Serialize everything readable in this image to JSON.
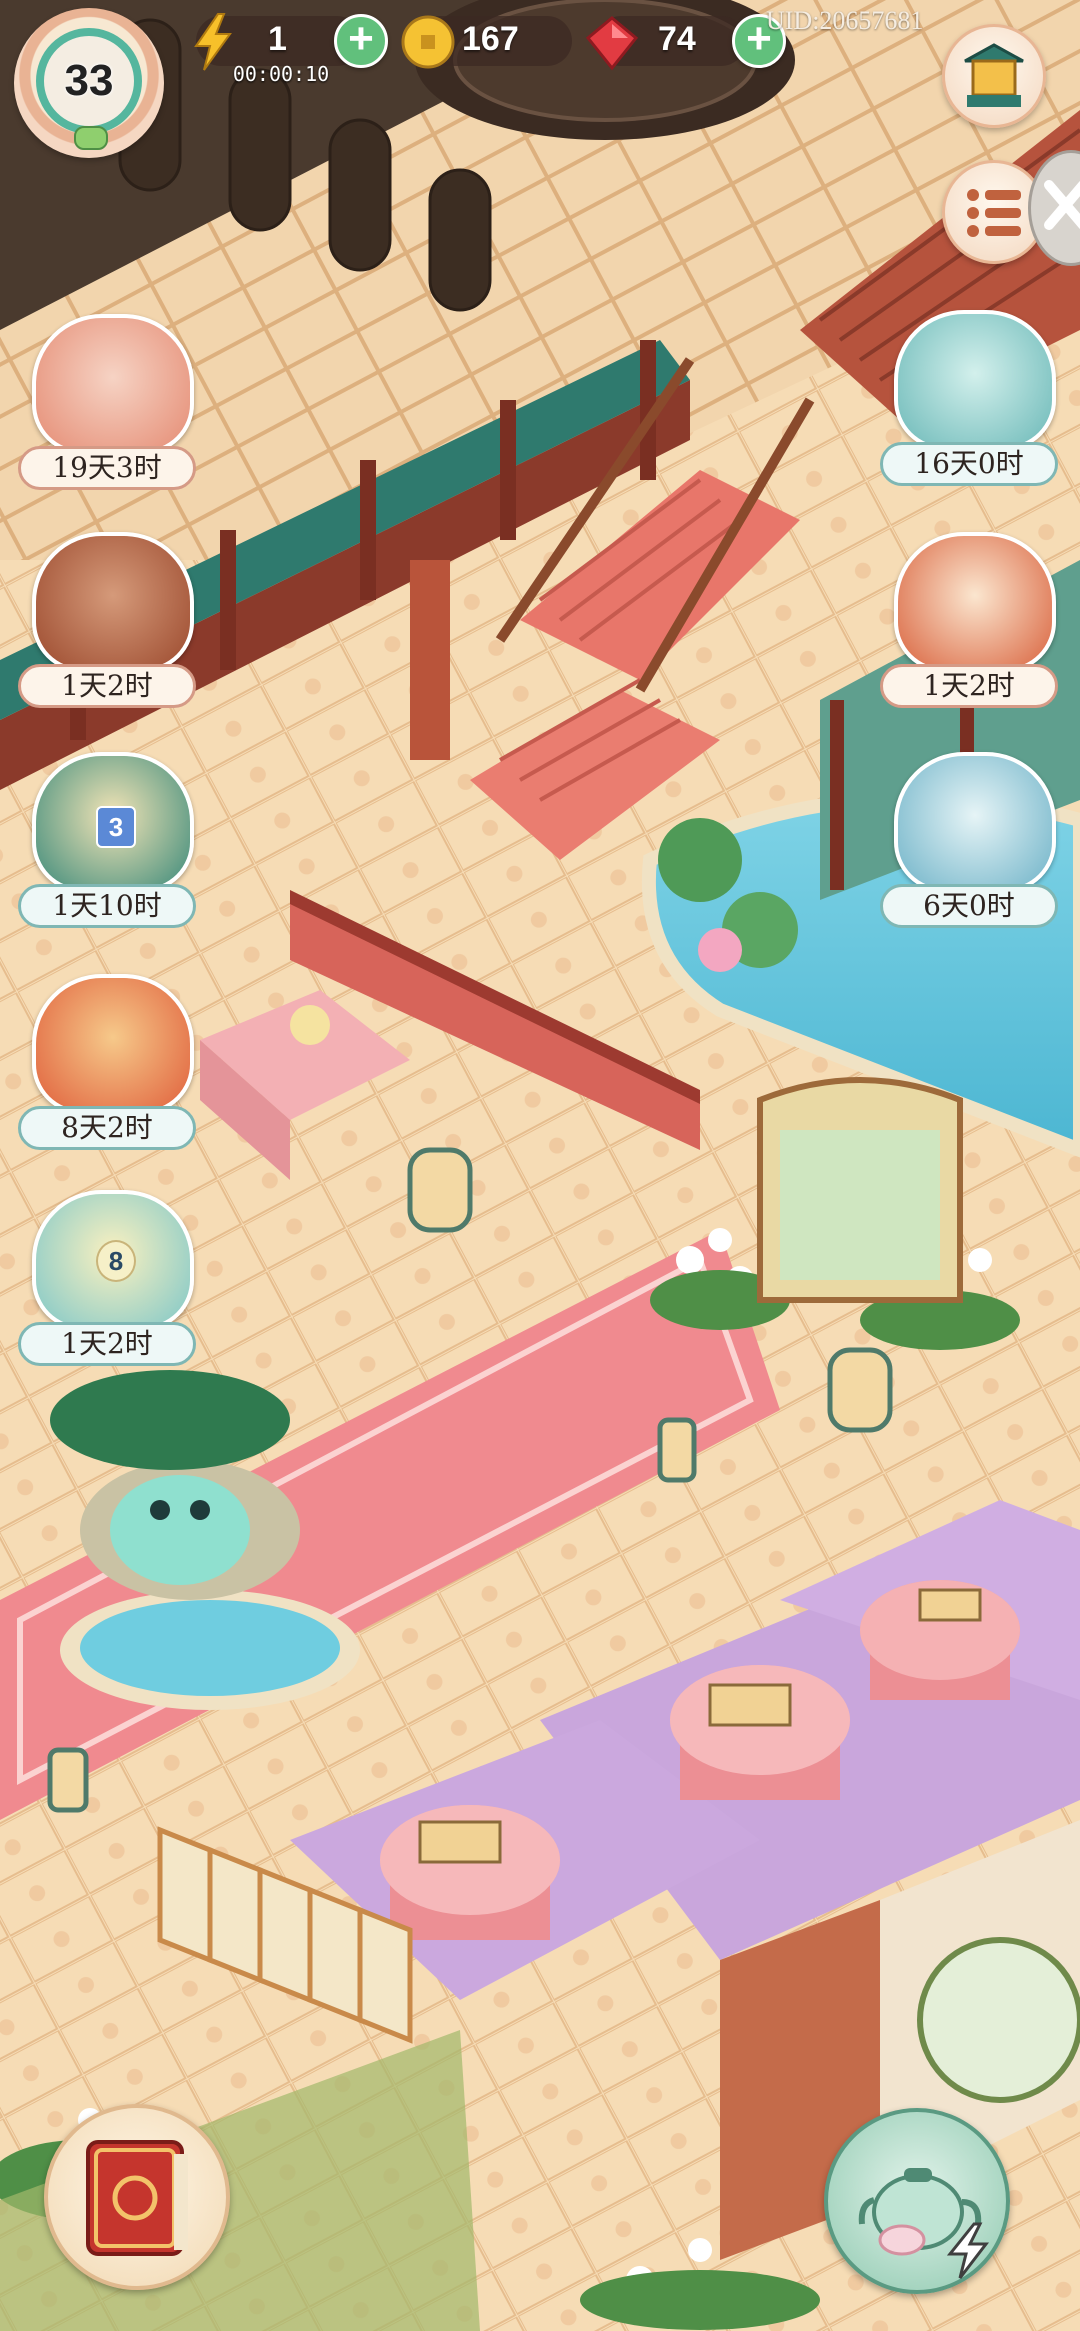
{
  "hud": {
    "level": "33",
    "energy": "1",
    "energy_timer": "00:00:10",
    "coins": "167",
    "gems": "74",
    "uid": "UID:20657681"
  },
  "events_left": [
    {
      "id": "event-book-scroll",
      "time": "19天3时",
      "icon": "scroll-books-icon"
    },
    {
      "id": "event-tea-set",
      "time": "1天2时",
      "icon": "teapot-icon"
    },
    {
      "id": "event-shop-3",
      "time": "1天10时",
      "icon": "shop-gold-icon",
      "badge": "3"
    },
    {
      "id": "event-autumn-bowl",
      "time": "8天2时",
      "icon": "autumn-bowl-icon"
    },
    {
      "id": "event-lotus-8",
      "time": "1天2时",
      "icon": "lotus-icon",
      "badge": "8"
    }
  ],
  "events_right": [
    {
      "id": "event-bath-cat",
      "time": "16天0时",
      "icon": "bath-cat-icon"
    },
    {
      "id": "event-lucky-cat",
      "time": "1天2时",
      "icon": "lucky-cat-icon"
    },
    {
      "id": "event-gift-cat",
      "time": "6天0时",
      "icon": "gift-cat-icon"
    }
  ],
  "colors": {
    "hud_pill": "#3c2823",
    "plus_green": "#61c07c",
    "label_border_warm": "#d59a86",
    "label_border_teal": "#7fb7b4"
  }
}
